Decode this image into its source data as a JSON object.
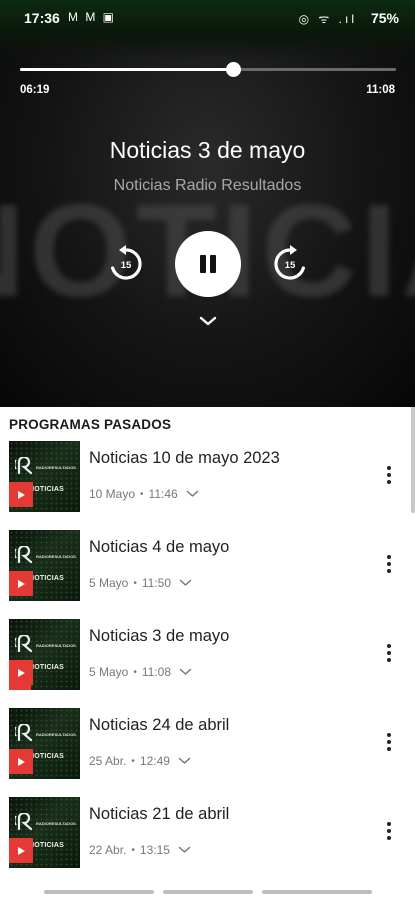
{
  "status_bar": {
    "time": "17:36",
    "left_icons": "M M ▣",
    "right_icons": "◎ ᯤ .ıl",
    "battery": "75%"
  },
  "player": {
    "background_word": "NOTICIAS",
    "elapsed": "06:19",
    "total": "11:08",
    "progress_fraction": 0.567,
    "title": "Noticias 3 de mayo",
    "subtitle": "Noticias Radio Resultados",
    "skip_back_label": "15",
    "skip_forward_label": "15"
  },
  "section_heading": "PROGRAMAS PASADOS",
  "episodes": [
    {
      "title": "Noticias 10 de mayo 2023",
      "date": "10 Mayo",
      "duration": "11:46",
      "progress": 0
    },
    {
      "title": "Noticias 4 de mayo",
      "date": "5 Mayo",
      "duration": "11:50",
      "progress": 0
    },
    {
      "title": "Noticias 3 de mayo",
      "date": "5 Mayo",
      "duration": "11:08",
      "progress": 0.57
    },
    {
      "title": "Noticias 24 de abril",
      "date": "25 Abr.",
      "duration": "12:49",
      "progress": 0
    },
    {
      "title": "Noticias 21 de abril",
      "date": "22 Abr.",
      "duration": "13:15",
      "progress": 0
    }
  ],
  "thumbnail": {
    "brand": "RADIORESULTADOS",
    "word": "NOTICIAS"
  },
  "colors": {
    "accent": "#e53935",
    "sheet_background": "#ffffff",
    "player_background": "#141414"
  }
}
